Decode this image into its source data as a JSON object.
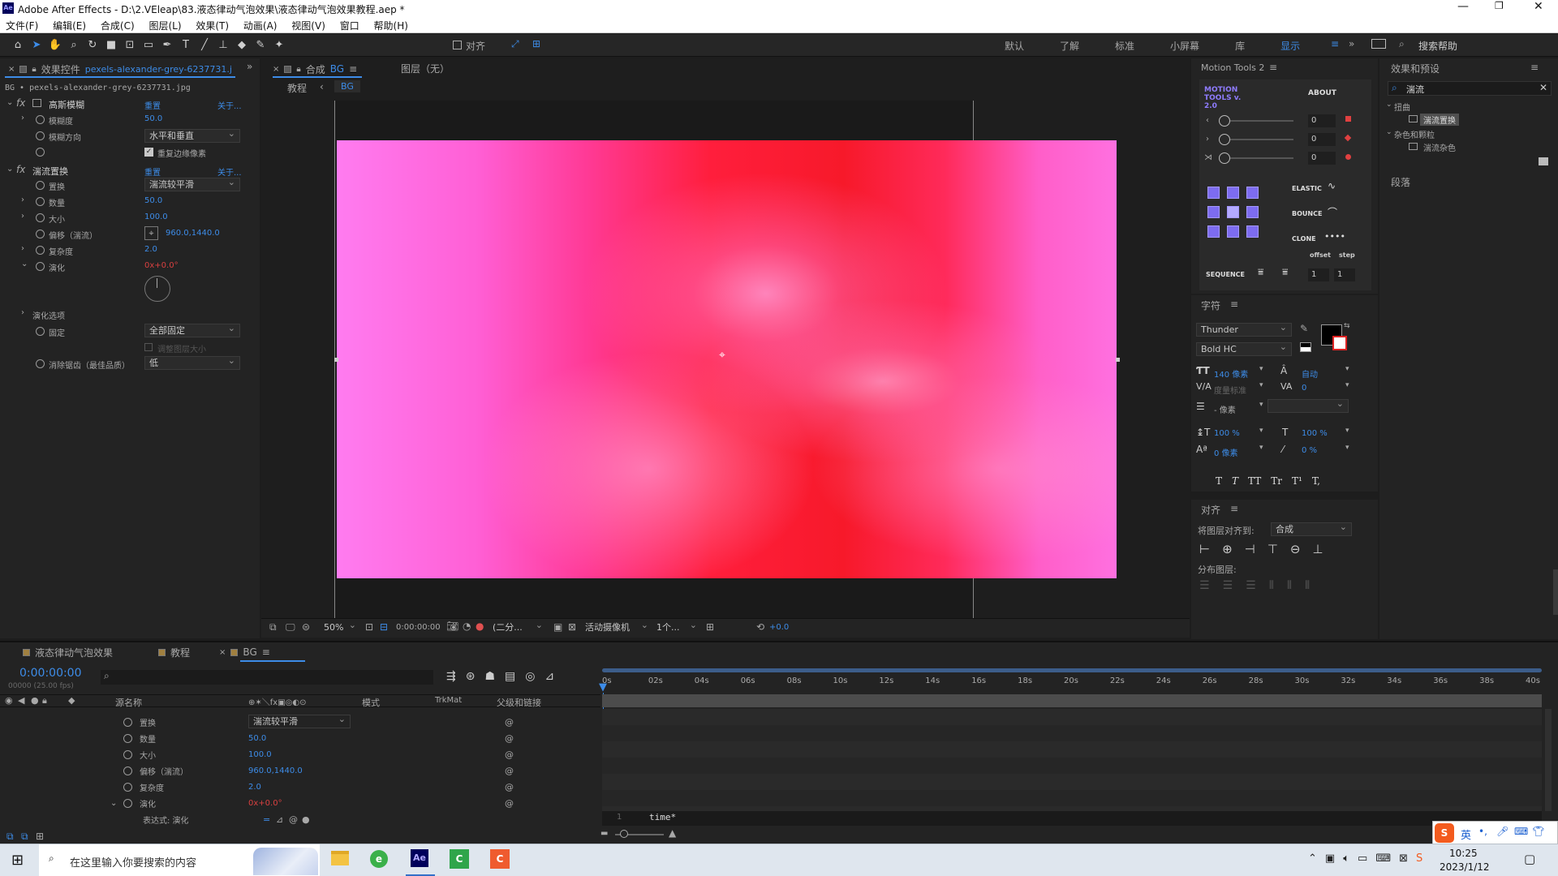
{
  "window": {
    "title": "Adobe After Effects - D:\\2.VEleap\\83.液态律动气泡效果\\液态律动气泡效果教程.aep *"
  },
  "menu": [
    "文件(F)",
    "编辑(E)",
    "合成(C)",
    "图层(L)",
    "效果(T)",
    "动画(A)",
    "视图(V)",
    "窗口",
    "帮助(H)"
  ],
  "toolbar": {
    "align_label": "对齐",
    "workspaces": [
      "默认",
      "了解",
      "标准",
      "小屏幕",
      "库",
      "显示"
    ],
    "search_help": "搜索帮助"
  },
  "effect_controls": {
    "tab_label": "效果控件",
    "tab_file": "pexels-alexander-grey-6237731.j",
    "layer_path": "BG • pexels-alexander-grey-6237731.jpg",
    "blur": {
      "name": "高斯模糊",
      "reset": "重置",
      "about": "关于...",
      "p1_label": "模糊度",
      "p1_value": "50.0",
      "p2_label": "模糊方向",
      "p2_value": "水平和垂直",
      "p3_label": "重复边缘像素"
    },
    "displace": {
      "name": "湍流置换",
      "reset": "重置",
      "about": "关于...",
      "params": [
        {
          "label": "置换",
          "value": "湍流较平滑"
        },
        {
          "label": "数量",
          "value": "50.0"
        },
        {
          "label": "大小",
          "value": "100.0"
        },
        {
          "label": "偏移（湍流）",
          "value": "960.0,1440.0"
        },
        {
          "label": "复杂度",
          "value": "2.0"
        },
        {
          "label": "演化",
          "value": "0x+0.0°"
        }
      ],
      "options_label": "演化选项",
      "pin_label": "固定",
      "pin_value": "全部固定",
      "resize_label": "调整图层大小",
      "antialias_label": "消除锯齿（最佳品质）",
      "antialias_value": "低"
    }
  },
  "composition": {
    "tab_prefix": "合成",
    "tab_name": "BG",
    "layer_label": "图层（无）",
    "breadcrumb": [
      "教程",
      "BG"
    ],
    "zoom": "50%",
    "timecode": "0:00:00:00",
    "resolution": "(二分...",
    "camera": "活动摄像机",
    "views": "1个...",
    "exposure": "+0.0"
  },
  "motion_tools": {
    "title": "Motion Tools 2",
    "logo": "MOTION TOOLS v. 2.0",
    "about": "ABOUT",
    "sliders": [
      "0",
      "0",
      "0"
    ],
    "elastic": "ELASTIC",
    "bounce": "BOUNCE",
    "clone": "CLONE",
    "offset": "offset",
    "step": "step",
    "sequence": "SEQUENCE",
    "seq_v1": "1",
    "seq_v2": "1"
  },
  "character": {
    "title": "字符",
    "font": "Thunder",
    "style": "Bold HC",
    "size": "140 像素",
    "leading": "自动",
    "kerning": "度量标准",
    "tracking": "0",
    "stroke": "- 像素",
    "vscale": "100 %",
    "hscale": "100 %",
    "baseline": "0 像素",
    "tsume": "0 %",
    "styles": [
      "T",
      "T",
      "TT",
      "Tr",
      "T¹",
      "T,"
    ]
  },
  "align": {
    "title": "对齐",
    "align_to_label": "将图层对齐到:",
    "align_to_value": "合成",
    "distribute_label": "分布图层:"
  },
  "effects_presets": {
    "title": "效果和预设",
    "search": "湍流",
    "cat1": "扭曲",
    "item1": "湍流置换",
    "cat2": "杂色和颗粒",
    "item2": "湍流杂色"
  },
  "paragraph": {
    "title": "段落"
  },
  "timeline": {
    "tabs": [
      "液态律动气泡效果",
      "教程",
      "BG"
    ],
    "timecode": "0:00:00:00",
    "fps": "00000 (25.00 fps)",
    "cols": {
      "source": "源名称",
      "mode": "模式",
      "trkmat": "TrkMat",
      "parent": "父级和链接"
    },
    "rows": [
      {
        "label": "置换",
        "value": "湍流较平滑"
      },
      {
        "label": "数量",
        "value": "50.0"
      },
      {
        "label": "大小",
        "value": "100.0"
      },
      {
        "label": "偏移（湍流）",
        "value": "960.0,1440.0"
      },
      {
        "label": "复杂度",
        "value": "2.0"
      },
      {
        "label": "演化",
        "value": "0x+0.0°"
      }
    ],
    "expression_label": "表达式: 演化",
    "expression_line": "1",
    "expression_code": "time*",
    "ticks": [
      "0s",
      "02s",
      "04s",
      "06s",
      "08s",
      "10s",
      "12s",
      "14s",
      "16s",
      "18s",
      "20s",
      "22s",
      "24s",
      "26s",
      "28s",
      "30s",
      "32s",
      "34s",
      "36s",
      "38s",
      "40s"
    ]
  },
  "taskbar": {
    "search_placeholder": "在这里输入你要搜索的内容",
    "time": "10:25",
    "date": "2023/1/12",
    "ime": "英"
  }
}
